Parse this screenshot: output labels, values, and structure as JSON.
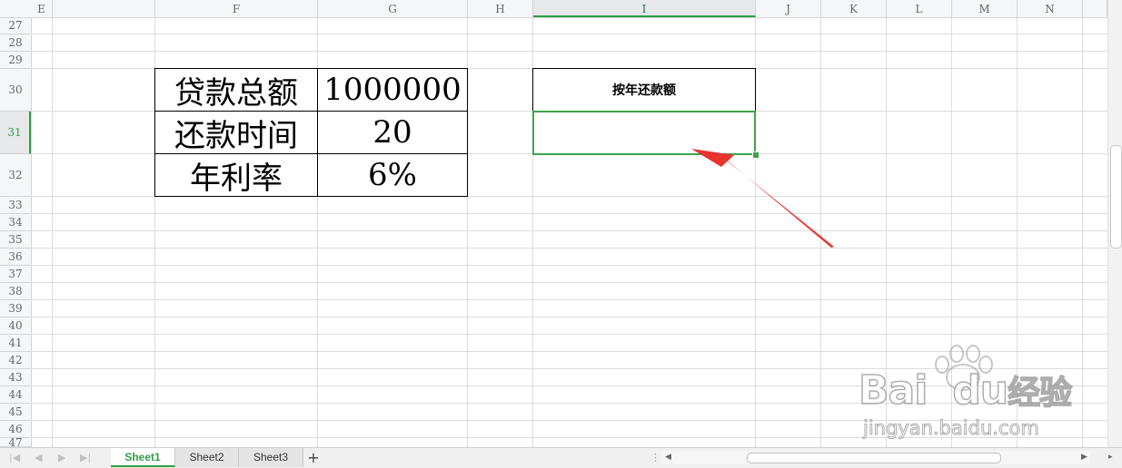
{
  "columns": [
    {
      "id": "e",
      "label": "E"
    },
    {
      "id": "f",
      "label": "F"
    },
    {
      "id": "g",
      "label": "G"
    },
    {
      "id": "h",
      "label": "H"
    },
    {
      "id": "i",
      "label": "I",
      "selected": true
    },
    {
      "id": "j",
      "label": "J"
    },
    {
      "id": "k",
      "label": "K"
    },
    {
      "id": "l",
      "label": "L"
    },
    {
      "id": "m",
      "label": "M"
    },
    {
      "id": "n",
      "label": "N"
    }
  ],
  "rows": [
    {
      "label": "27"
    },
    {
      "label": "28"
    },
    {
      "label": "29"
    },
    {
      "label": "30"
    },
    {
      "label": "31",
      "selected": true
    },
    {
      "label": "32"
    },
    {
      "label": "33"
    },
    {
      "label": "34"
    },
    {
      "label": "35"
    },
    {
      "label": "36"
    },
    {
      "label": "37"
    },
    {
      "label": "38"
    },
    {
      "label": "39"
    },
    {
      "label": "40"
    },
    {
      "label": "41"
    },
    {
      "label": "42"
    },
    {
      "label": "43"
    },
    {
      "label": "44"
    },
    {
      "label": "45"
    },
    {
      "label": "46"
    },
    {
      "label": "47"
    }
  ],
  "loan_table": {
    "rows": [
      {
        "label": "贷款总额",
        "value": "1000000"
      },
      {
        "label": "还款时间",
        "value": "20"
      },
      {
        "label": "年利率",
        "value": "6%"
      }
    ]
  },
  "annual_payment": {
    "header": "按年还款额",
    "value": ""
  },
  "sheet_tabs": [
    {
      "label": "Sheet1",
      "active": true
    },
    {
      "label": "Sheet2"
    },
    {
      "label": "Sheet3"
    }
  ],
  "add_tab_label": "+",
  "watermark": {
    "brand": "Bai",
    "brand2": "du",
    "suffix": "经验",
    "url": "jingyan.baidu.com"
  },
  "colors": {
    "accent": "#2f9e45",
    "arrow": "#e8332f",
    "grid": "#dcdcdc"
  }
}
